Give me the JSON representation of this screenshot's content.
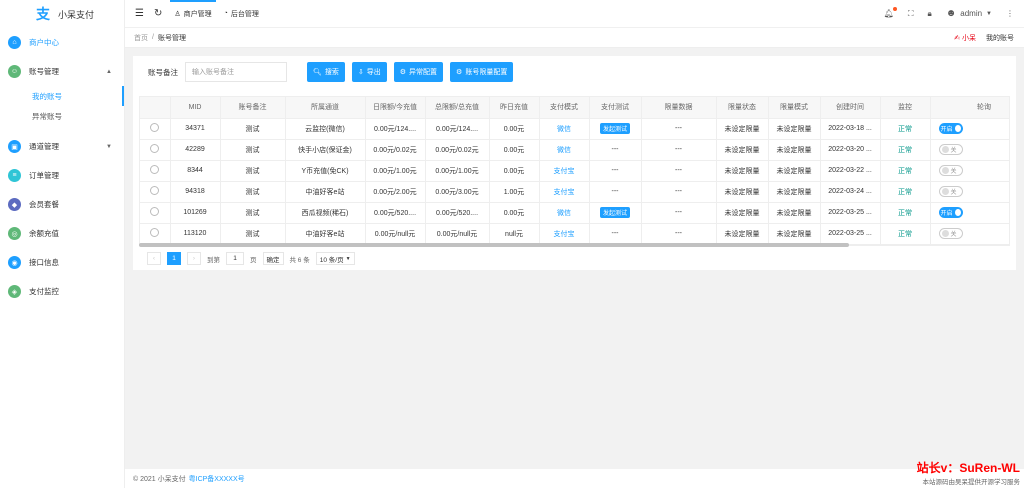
{
  "app": {
    "name": "小呆支付"
  },
  "sidebar": {
    "items": [
      {
        "label": "商户中心",
        "color": "#1e9fff",
        "glyph": "⌂",
        "active": true
      },
      {
        "label": "账号管理",
        "color": "#5fb878",
        "glyph": "☺",
        "expanded": true
      },
      {
        "label": "通道管理",
        "color": "#1e9fff",
        "glyph": "▣",
        "expanded": false
      },
      {
        "label": "订单管理",
        "color": "#2fc5d6",
        "glyph": "≡"
      },
      {
        "label": "会员套餐",
        "color": "#5c6bc0",
        "glyph": "◆"
      },
      {
        "label": "余额充值",
        "color": "#5fb878",
        "glyph": "◎"
      },
      {
        "label": "接口信息",
        "color": "#1e9fff",
        "glyph": "◉"
      },
      {
        "label": "支付监控",
        "color": "#5fb878",
        "glyph": "◈"
      }
    ],
    "sub_items": [
      "我的账号",
      "异常账号"
    ]
  },
  "topbar": {
    "links": [
      "商户管理",
      "后台管理"
    ],
    "user": "admin"
  },
  "breadcrumb": {
    "home": "首页",
    "sep": "/",
    "current": "账号管理"
  },
  "breadbar_right": {
    "brand": "小呆",
    "account": "我的账号"
  },
  "filter": {
    "label": "账号备注",
    "placeholder": "输入账号备注",
    "buttons": [
      "搜索",
      "导出",
      "异常配置",
      "账号限量配置"
    ]
  },
  "table": {
    "headers": [
      "",
      "MID",
      "账号备注",
      "所属通道",
      "日限额/今充值",
      "总限额/总充值",
      "昨日充值",
      "支付模式",
      "支付测试",
      "限量数据",
      "限量状态",
      "限量模式",
      "创建时间",
      "监控",
      "轮询"
    ],
    "rows": [
      {
        "mid": "34371",
        "note": "测试",
        "channel": "云监控(微信)",
        "daily": "0.00元/124....",
        "total": "0.00元/124....",
        "yesterday": "0.00元",
        "mode": "微信",
        "test": "发起测试",
        "limit_data": "---",
        "limit_status": "未设定限量",
        "limit_mode": "未设定限量",
        "created": "2022-03-18 ...",
        "monitor": "正常",
        "poll": "开启",
        "poll_on": true
      },
      {
        "mid": "42289",
        "note": "测试",
        "channel": "快手小店(保证金)",
        "daily": "0.00元/0.02元",
        "total": "0.00元/0.02元",
        "yesterday": "0.00元",
        "mode": "微信",
        "test": "---",
        "limit_data": "---",
        "limit_status": "未设定限量",
        "limit_mode": "未设定限量",
        "created": "2022-03-20 ...",
        "monitor": "正常",
        "poll": "关",
        "poll_on": false
      },
      {
        "mid": "8344",
        "note": "测试",
        "channel": "Y币充值(免CK)",
        "daily": "0.00元/1.00元",
        "total": "0.00元/1.00元",
        "yesterday": "0.00元",
        "mode": "支付宝",
        "test": "---",
        "limit_data": "---",
        "limit_status": "未设定限量",
        "limit_mode": "未设定限量",
        "created": "2022-03-22 ...",
        "monitor": "正常",
        "poll": "关",
        "poll_on": false
      },
      {
        "mid": "94318",
        "note": "测试",
        "channel": "中油好客e站",
        "daily": "0.00元/2.00元",
        "total": "0.00元/3.00元",
        "yesterday": "1.00元",
        "mode": "支付宝",
        "test": "---",
        "limit_data": "---",
        "limit_status": "未设定限量",
        "limit_mode": "未设定限量",
        "created": "2022-03-24 ...",
        "monitor": "正常",
        "poll": "关",
        "poll_on": false
      },
      {
        "mid": "101269",
        "note": "测试",
        "channel": "西瓜视频(稀石)",
        "daily": "0.00元/520....",
        "total": "0.00元/520....",
        "yesterday": "0.00元",
        "mode": "微信",
        "test": "发起测试",
        "limit_data": "---",
        "limit_status": "未设定限量",
        "limit_mode": "未设定限量",
        "created": "2022-03-25 ...",
        "monitor": "正常",
        "poll": "开启",
        "poll_on": true
      },
      {
        "mid": "113120",
        "note": "测试",
        "channel": "中油好客e站",
        "daily": "0.00元/null元",
        "total": "0.00元/null元",
        "yesterday": "null元",
        "mode": "支付宝",
        "test": "---",
        "limit_data": "---",
        "limit_status": "未设定限量",
        "limit_mode": "未设定限量",
        "created": "2022-03-25 ...",
        "monitor": "正常",
        "poll": "关",
        "poll_on": false
      }
    ]
  },
  "pager": {
    "current": "1",
    "goto_label": "到第",
    "page_unit": "页",
    "confirm": "确定",
    "total": "共 6 条",
    "page_size": "10 条/页"
  },
  "footer": {
    "copyright": "© 2021 小呆支付",
    "icp": "粤ICP备XXXXX号"
  },
  "watermark": {
    "title": "站长v：SuRen-WL",
    "subtitle": "本站源码由吴呆提供开源学习服务"
  }
}
